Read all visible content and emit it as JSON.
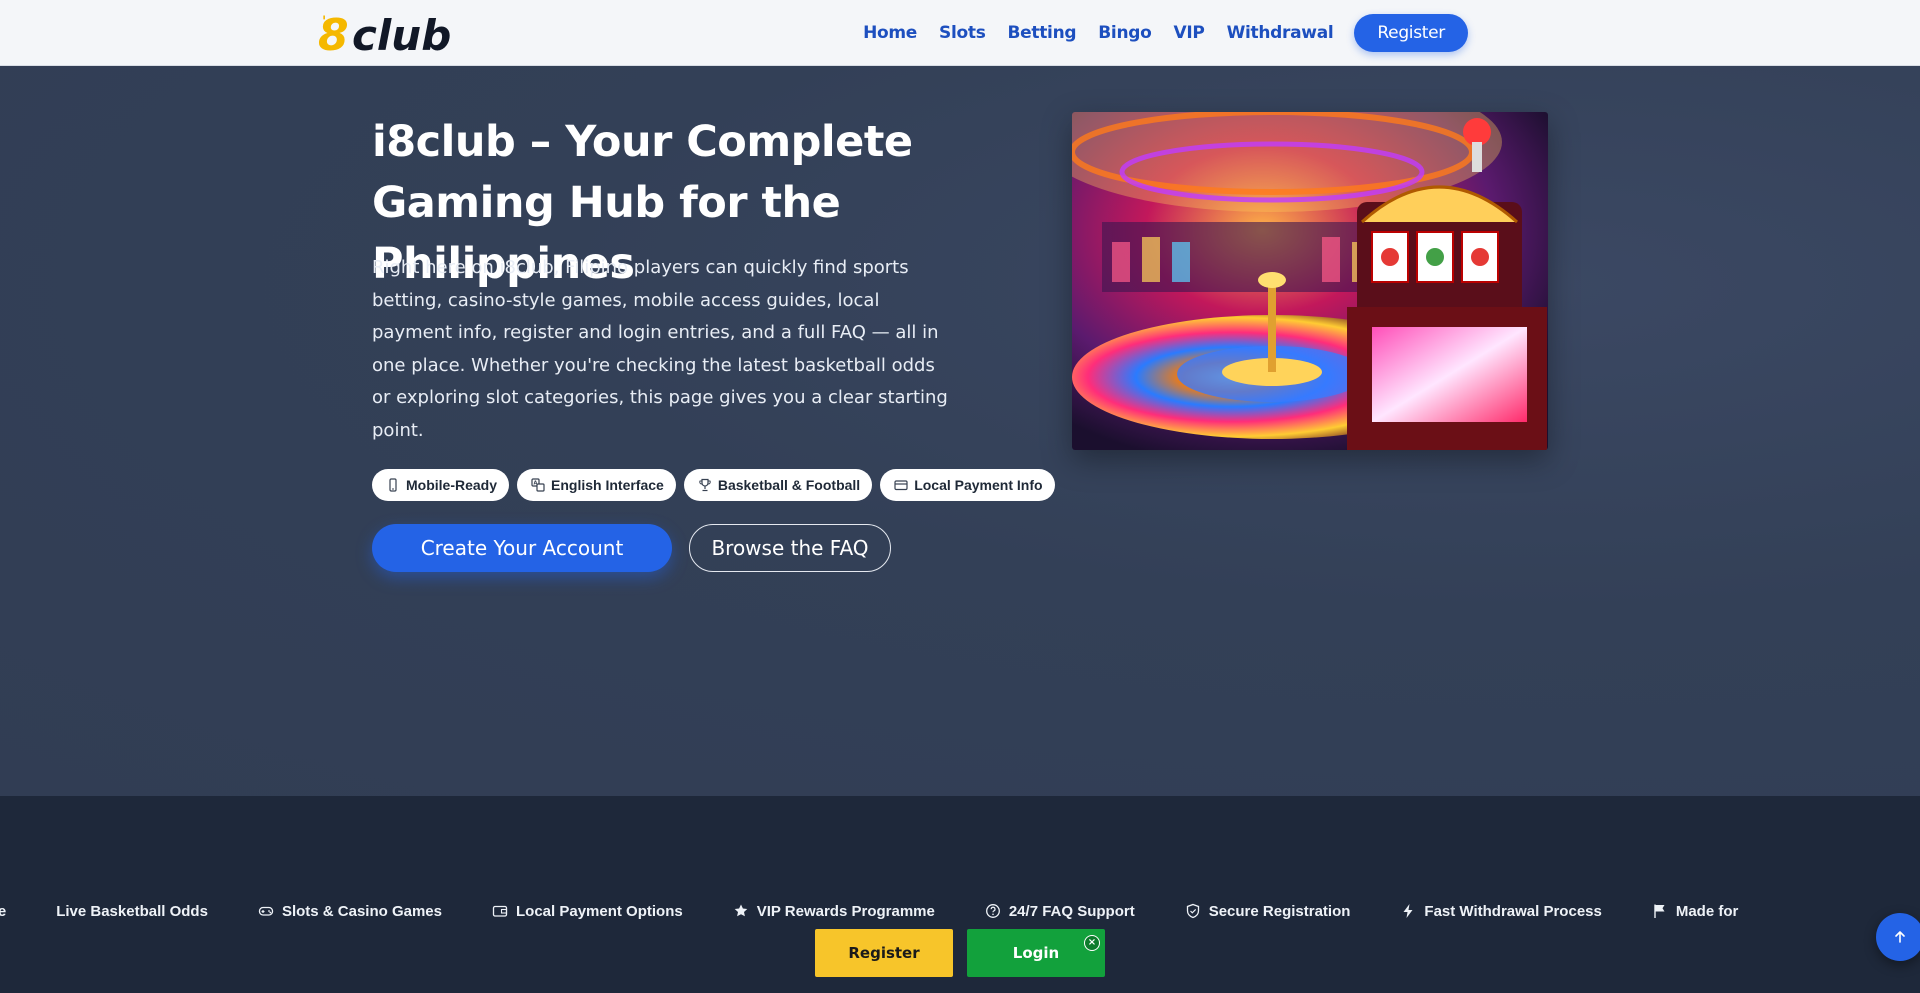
{
  "header": {
    "logo_text": "i8club",
    "nav": [
      "Home",
      "Slots",
      "Betting",
      "Bingo",
      "VIP",
      "Withdrawal"
    ],
    "register_label": "Register"
  },
  "hero": {
    "title": "i8club – Your Complete Gaming Hub for the Philippines",
    "description": "Right here on i8club, Filipino players can quickly find sports betting, casino-style games, mobile access guides, local payment info, register and login entries, and a full FAQ — all in one place. Whether you're checking the latest basketball odds or exploring slot categories, this page gives you a clear starting point.",
    "chips": [
      {
        "icon": "phone-icon",
        "label": "Mobile-Ready"
      },
      {
        "icon": "language-icon",
        "label": "English Interface"
      },
      {
        "icon": "trophy-icon",
        "label": "Basketball & Football"
      },
      {
        "icon": "card-icon",
        "label": "Local Payment Info"
      }
    ],
    "cta_primary": "Create Your Account",
    "cta_secondary": "Browse the FAQ"
  },
  "ticker": {
    "items": [
      {
        "icon": "",
        "label": "ence"
      },
      {
        "icon": "",
        "label": "Live Basketball Odds"
      },
      {
        "icon": "gamepad-icon",
        "label": "Slots & Casino Games"
      },
      {
        "icon": "wallet-icon",
        "label": "Local Payment Options"
      },
      {
        "icon": "star-icon",
        "label": "VIP Rewards Programme"
      },
      {
        "icon": "help-icon",
        "label": "24/7 FAQ Support"
      },
      {
        "icon": "shield-icon",
        "label": "Secure Registration"
      },
      {
        "icon": "bolt-icon",
        "label": "Fast Withdrawal Process"
      },
      {
        "icon": "flag-icon",
        "label": "Made for Fi"
      }
    ]
  },
  "sticky": {
    "register_label": "Register",
    "login_label": "Login",
    "close_glyph": "×"
  },
  "colors": {
    "primary_blue": "#2463e6",
    "header_bg": "#f4f6f9",
    "hero_bg": "#334057",
    "band_bg": "#1e283a",
    "sticky_register": "#f7c52a",
    "sticky_login": "#12a13c"
  }
}
